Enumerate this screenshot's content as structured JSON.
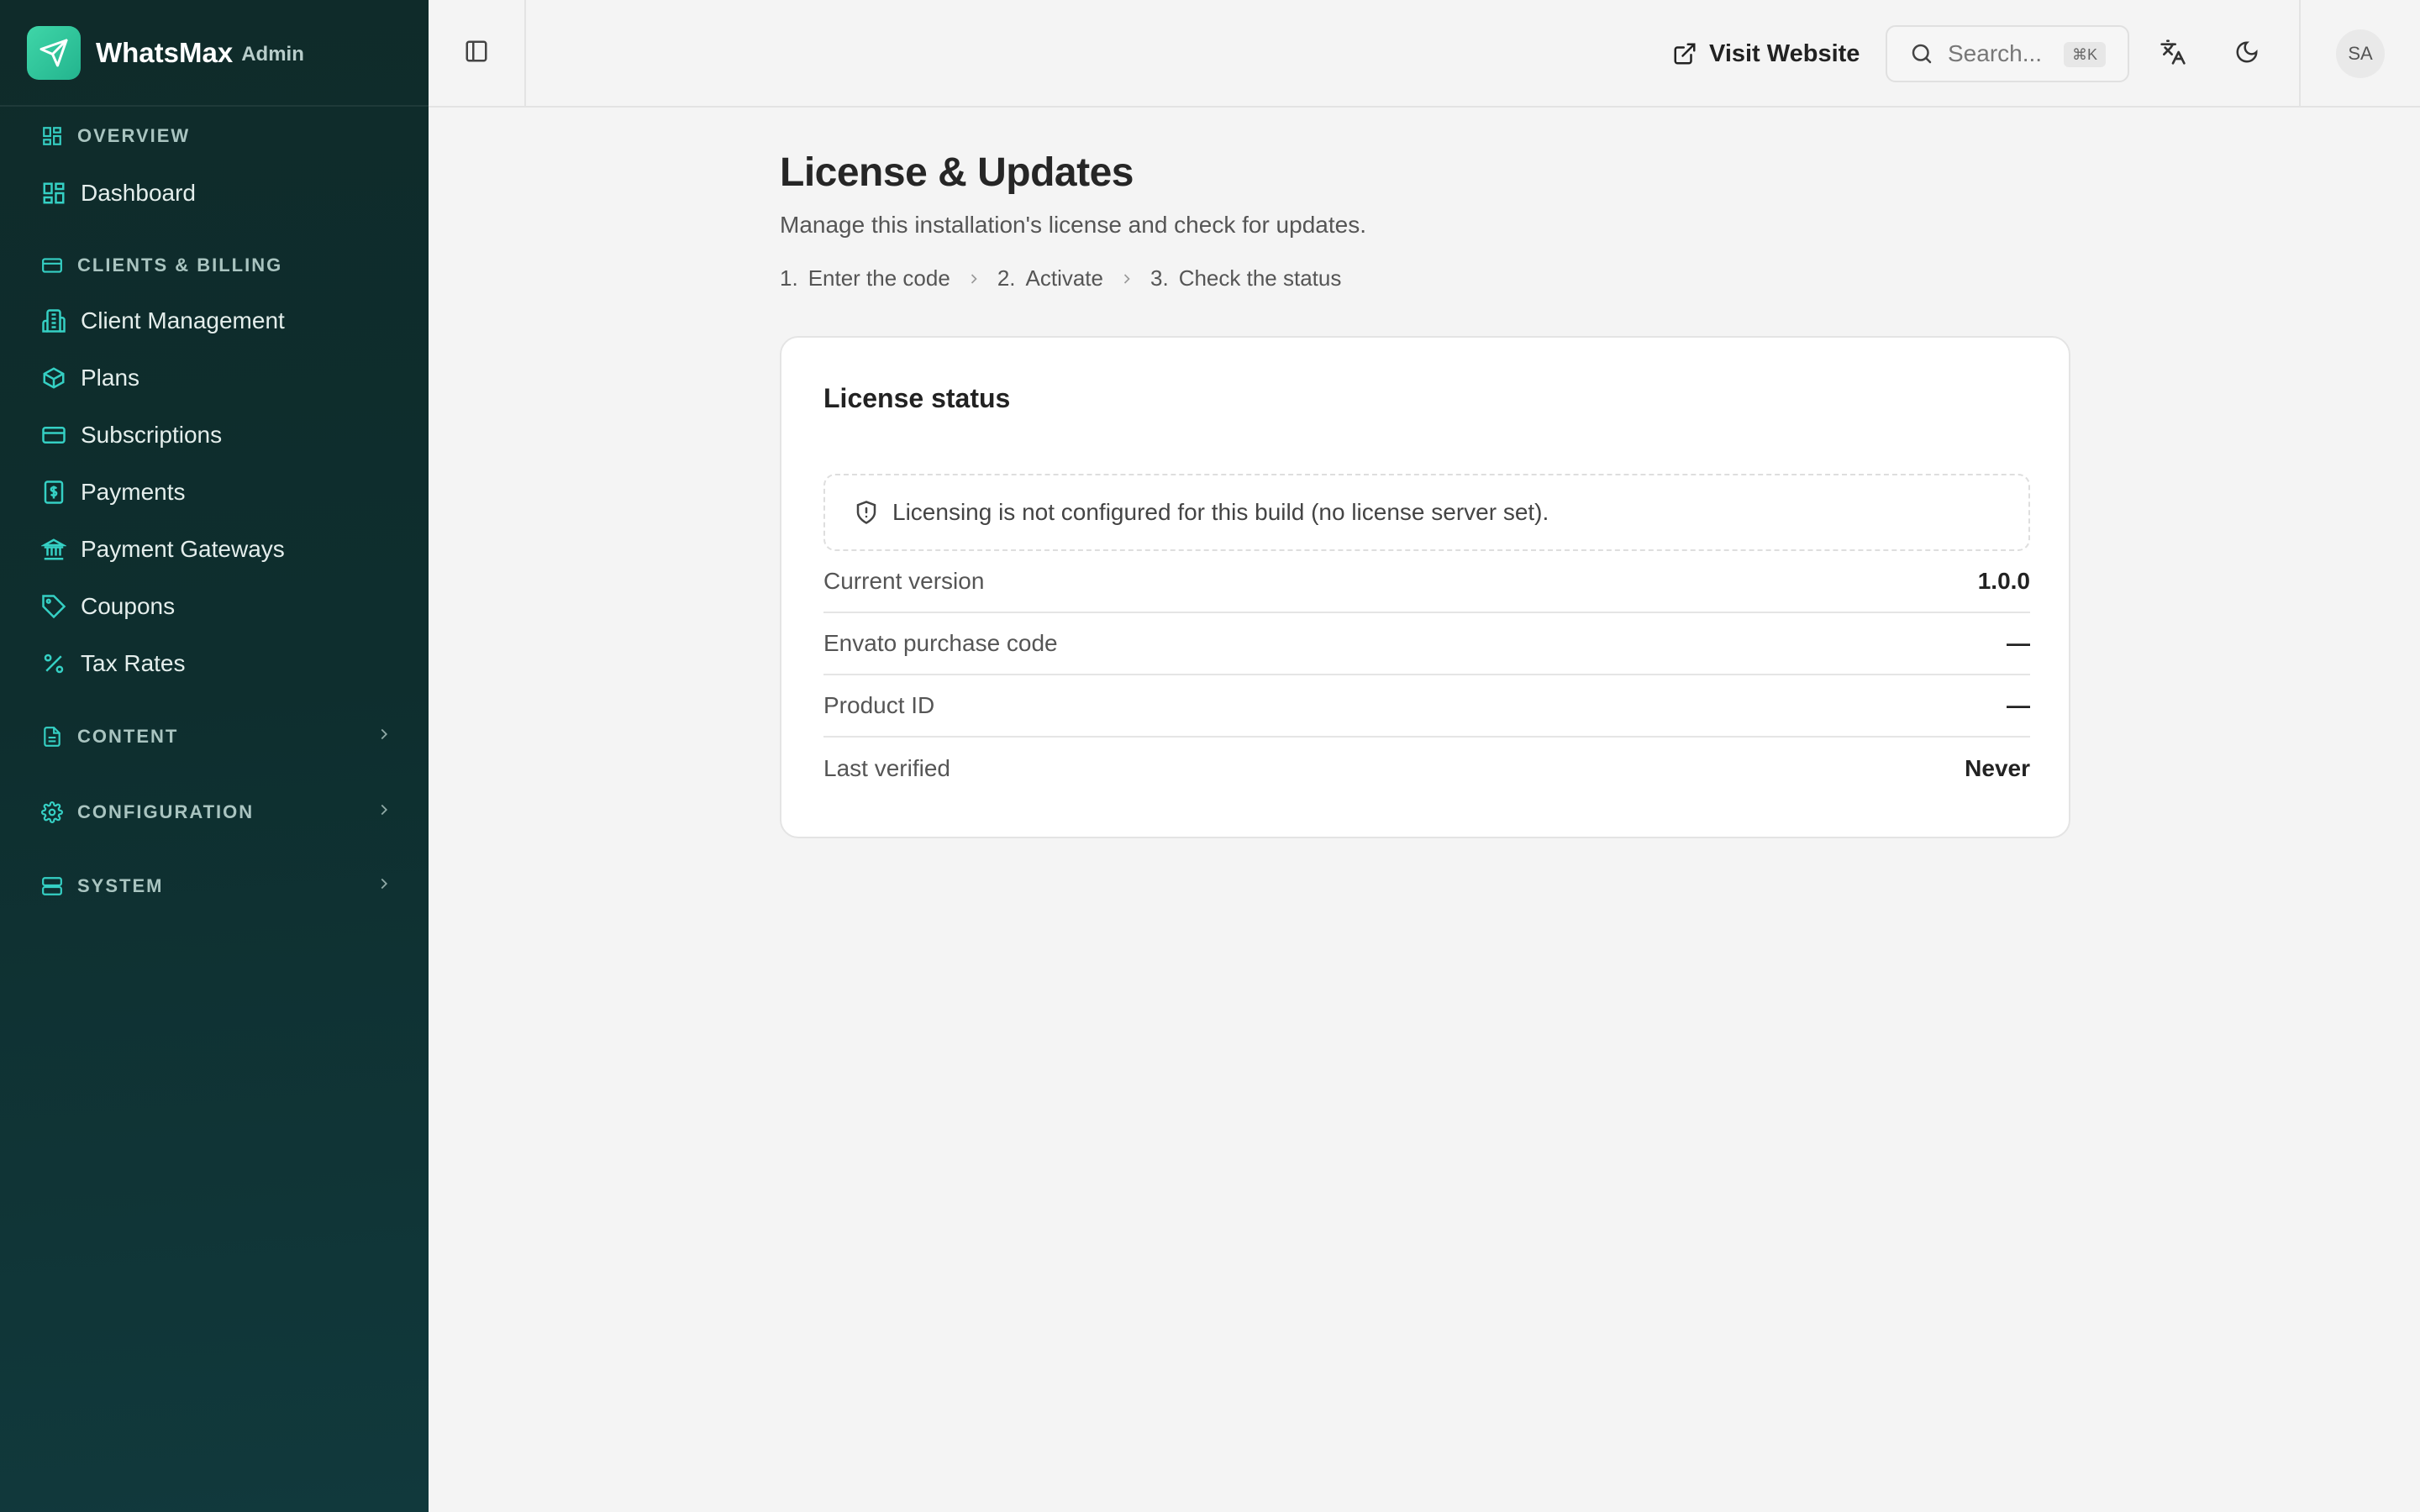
{
  "brand": {
    "name": "WhatsMax",
    "sub": "Admin"
  },
  "sidebar": {
    "sections": [
      {
        "label": "OVERVIEW",
        "items": [
          {
            "label": "Dashboard",
            "icon": "dashboard-icon"
          }
        ]
      },
      {
        "label": "CLIENTS & BILLING",
        "items": [
          {
            "label": "Client Management",
            "icon": "building-icon"
          },
          {
            "label": "Plans",
            "icon": "package-icon"
          },
          {
            "label": "Subscriptions",
            "icon": "credit-card-icon"
          },
          {
            "label": "Payments",
            "icon": "receipt-dollar-icon"
          },
          {
            "label": "Payment Gateways",
            "icon": "bank-icon"
          },
          {
            "label": "Coupons",
            "icon": "tag-icon"
          },
          {
            "label": "Tax Rates",
            "icon": "percent-icon"
          }
        ]
      },
      {
        "label": "CONTENT",
        "collapsed": true
      },
      {
        "label": "CONFIGURATION",
        "collapsed": true
      },
      {
        "label": "SYSTEM",
        "collapsed": true
      }
    ]
  },
  "topbar": {
    "visit_label": "Visit Website",
    "search_placeholder": "Search...",
    "search_shortcut": "⌘K",
    "avatar_initials": "SA"
  },
  "page": {
    "title": "License & Updates",
    "subtitle": "Manage this installation's license and check for updates.",
    "steps": [
      {
        "num": "1.",
        "label": "Enter the code"
      },
      {
        "num": "2.",
        "label": "Activate"
      },
      {
        "num": "3.",
        "label": "Check the status"
      }
    ]
  },
  "card": {
    "title": "License status",
    "notice": "Licensing is not configured for this build (no license server set).",
    "rows": [
      {
        "key": "Current version",
        "value": "1.0.0"
      },
      {
        "key": "Envato purchase code",
        "value": "—"
      },
      {
        "key": "Product ID",
        "value": "—"
      },
      {
        "key": "Last verified",
        "value": "Never"
      }
    ]
  },
  "colors": {
    "accent": "#2fc7a0",
    "sidebar_bg": "#0f2b2a",
    "page_bg": "#f4f4f4"
  }
}
